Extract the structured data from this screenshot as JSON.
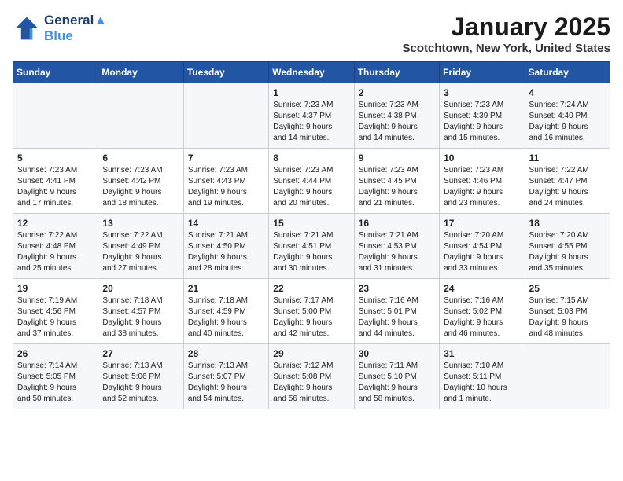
{
  "header": {
    "logo_line1": "General",
    "logo_line2": "Blue",
    "month": "January 2025",
    "location": "Scotchtown, New York, United States"
  },
  "days_of_week": [
    "Sunday",
    "Monday",
    "Tuesday",
    "Wednesday",
    "Thursday",
    "Friday",
    "Saturday"
  ],
  "weeks": [
    [
      {
        "day": "",
        "info": ""
      },
      {
        "day": "",
        "info": ""
      },
      {
        "day": "",
        "info": ""
      },
      {
        "day": "1",
        "info": "Sunrise: 7:23 AM\nSunset: 4:37 PM\nDaylight: 9 hours\nand 14 minutes."
      },
      {
        "day": "2",
        "info": "Sunrise: 7:23 AM\nSunset: 4:38 PM\nDaylight: 9 hours\nand 14 minutes."
      },
      {
        "day": "3",
        "info": "Sunrise: 7:23 AM\nSunset: 4:39 PM\nDaylight: 9 hours\nand 15 minutes."
      },
      {
        "day": "4",
        "info": "Sunrise: 7:24 AM\nSunset: 4:40 PM\nDaylight: 9 hours\nand 16 minutes."
      }
    ],
    [
      {
        "day": "5",
        "info": "Sunrise: 7:23 AM\nSunset: 4:41 PM\nDaylight: 9 hours\nand 17 minutes."
      },
      {
        "day": "6",
        "info": "Sunrise: 7:23 AM\nSunset: 4:42 PM\nDaylight: 9 hours\nand 18 minutes."
      },
      {
        "day": "7",
        "info": "Sunrise: 7:23 AM\nSunset: 4:43 PM\nDaylight: 9 hours\nand 19 minutes."
      },
      {
        "day": "8",
        "info": "Sunrise: 7:23 AM\nSunset: 4:44 PM\nDaylight: 9 hours\nand 20 minutes."
      },
      {
        "day": "9",
        "info": "Sunrise: 7:23 AM\nSunset: 4:45 PM\nDaylight: 9 hours\nand 21 minutes."
      },
      {
        "day": "10",
        "info": "Sunrise: 7:23 AM\nSunset: 4:46 PM\nDaylight: 9 hours\nand 23 minutes."
      },
      {
        "day": "11",
        "info": "Sunrise: 7:22 AM\nSunset: 4:47 PM\nDaylight: 9 hours\nand 24 minutes."
      }
    ],
    [
      {
        "day": "12",
        "info": "Sunrise: 7:22 AM\nSunset: 4:48 PM\nDaylight: 9 hours\nand 25 minutes."
      },
      {
        "day": "13",
        "info": "Sunrise: 7:22 AM\nSunset: 4:49 PM\nDaylight: 9 hours\nand 27 minutes."
      },
      {
        "day": "14",
        "info": "Sunrise: 7:21 AM\nSunset: 4:50 PM\nDaylight: 9 hours\nand 28 minutes."
      },
      {
        "day": "15",
        "info": "Sunrise: 7:21 AM\nSunset: 4:51 PM\nDaylight: 9 hours\nand 30 minutes."
      },
      {
        "day": "16",
        "info": "Sunrise: 7:21 AM\nSunset: 4:53 PM\nDaylight: 9 hours\nand 31 minutes."
      },
      {
        "day": "17",
        "info": "Sunrise: 7:20 AM\nSunset: 4:54 PM\nDaylight: 9 hours\nand 33 minutes."
      },
      {
        "day": "18",
        "info": "Sunrise: 7:20 AM\nSunset: 4:55 PM\nDaylight: 9 hours\nand 35 minutes."
      }
    ],
    [
      {
        "day": "19",
        "info": "Sunrise: 7:19 AM\nSunset: 4:56 PM\nDaylight: 9 hours\nand 37 minutes."
      },
      {
        "day": "20",
        "info": "Sunrise: 7:18 AM\nSunset: 4:57 PM\nDaylight: 9 hours\nand 38 minutes."
      },
      {
        "day": "21",
        "info": "Sunrise: 7:18 AM\nSunset: 4:59 PM\nDaylight: 9 hours\nand 40 minutes."
      },
      {
        "day": "22",
        "info": "Sunrise: 7:17 AM\nSunset: 5:00 PM\nDaylight: 9 hours\nand 42 minutes."
      },
      {
        "day": "23",
        "info": "Sunrise: 7:16 AM\nSunset: 5:01 PM\nDaylight: 9 hours\nand 44 minutes."
      },
      {
        "day": "24",
        "info": "Sunrise: 7:16 AM\nSunset: 5:02 PM\nDaylight: 9 hours\nand 46 minutes."
      },
      {
        "day": "25",
        "info": "Sunrise: 7:15 AM\nSunset: 5:03 PM\nDaylight: 9 hours\nand 48 minutes."
      }
    ],
    [
      {
        "day": "26",
        "info": "Sunrise: 7:14 AM\nSunset: 5:05 PM\nDaylight: 9 hours\nand 50 minutes."
      },
      {
        "day": "27",
        "info": "Sunrise: 7:13 AM\nSunset: 5:06 PM\nDaylight: 9 hours\nand 52 minutes."
      },
      {
        "day": "28",
        "info": "Sunrise: 7:13 AM\nSunset: 5:07 PM\nDaylight: 9 hours\nand 54 minutes."
      },
      {
        "day": "29",
        "info": "Sunrise: 7:12 AM\nSunset: 5:08 PM\nDaylight: 9 hours\nand 56 minutes."
      },
      {
        "day": "30",
        "info": "Sunrise: 7:11 AM\nSunset: 5:10 PM\nDaylight: 9 hours\nand 58 minutes."
      },
      {
        "day": "31",
        "info": "Sunrise: 7:10 AM\nSunset: 5:11 PM\nDaylight: 10 hours\nand 1 minute."
      },
      {
        "day": "",
        "info": ""
      }
    ]
  ]
}
